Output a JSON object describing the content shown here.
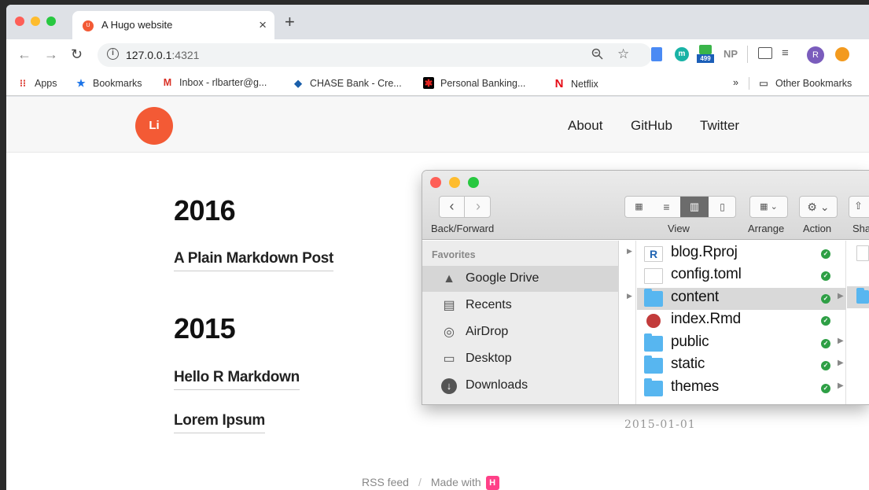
{
  "browser": {
    "tab_title": "A Hugo website",
    "tab_favicon": "U",
    "url_host": "127.0.0.1",
    "url_port": ":4321",
    "extensions": {
      "badge_count": "499",
      "np_label": "NP",
      "profile_initial": "R"
    }
  },
  "bookmarks": {
    "items": [
      {
        "label": "Apps",
        "icon": "apps-grid-icon"
      },
      {
        "label": "Bookmarks",
        "icon": "star-icon"
      },
      {
        "label": "Inbox - rlbarter@g...",
        "icon": "gmail-icon"
      },
      {
        "label": "CHASE Bank - Cre...",
        "icon": "chase-icon"
      },
      {
        "label": "Personal Banking...",
        "icon": "bank-icon"
      },
      {
        "label": "Netflix",
        "icon": "netflix-icon"
      }
    ],
    "overflow": "»",
    "other": "Other Bookmarks"
  },
  "site": {
    "logo": "Li",
    "nav": [
      "About",
      "GitHub",
      "Twitter"
    ],
    "years": [
      {
        "year": "2016",
        "posts": [
          "A Plain Markdown Post"
        ]
      },
      {
        "year": "2015",
        "posts": [
          "Hello R Markdown",
          "Lorem Ipsum"
        ]
      }
    ],
    "date": "2015-01-01",
    "footer": {
      "rss": "RSS feed",
      "sep": "/",
      "made_with": "Made with",
      "hugo_badge": "H"
    }
  },
  "finder": {
    "toolbar": {
      "back_forward": "Back/Forward",
      "view": "View",
      "arrange": "Arrange",
      "action": "Action",
      "share": "Sha"
    },
    "sidebar": {
      "heading": "Favorites",
      "items": [
        {
          "label": "Google Drive",
          "icon": "google-drive-icon",
          "selected": true
        },
        {
          "label": "Recents",
          "icon": "recents-icon"
        },
        {
          "label": "AirDrop",
          "icon": "airdrop-icon"
        },
        {
          "label": "Desktop",
          "icon": "desktop-icon"
        },
        {
          "label": "Downloads",
          "icon": "downloads-icon"
        }
      ]
    },
    "files": [
      {
        "name": "blog.Rproj",
        "type": "rproj",
        "folder": false,
        "selected": false
      },
      {
        "name": "config.toml",
        "type": "doc",
        "folder": false,
        "selected": false
      },
      {
        "name": "content",
        "type": "folder",
        "folder": true,
        "selected": true
      },
      {
        "name": "index.Rmd",
        "type": "rmd",
        "folder": false,
        "selected": false
      },
      {
        "name": "public",
        "type": "folder",
        "folder": true,
        "selected": false
      },
      {
        "name": "static",
        "type": "folder",
        "folder": true,
        "selected": false
      },
      {
        "name": "themes",
        "type": "folder",
        "folder": true,
        "selected": false
      }
    ]
  }
}
